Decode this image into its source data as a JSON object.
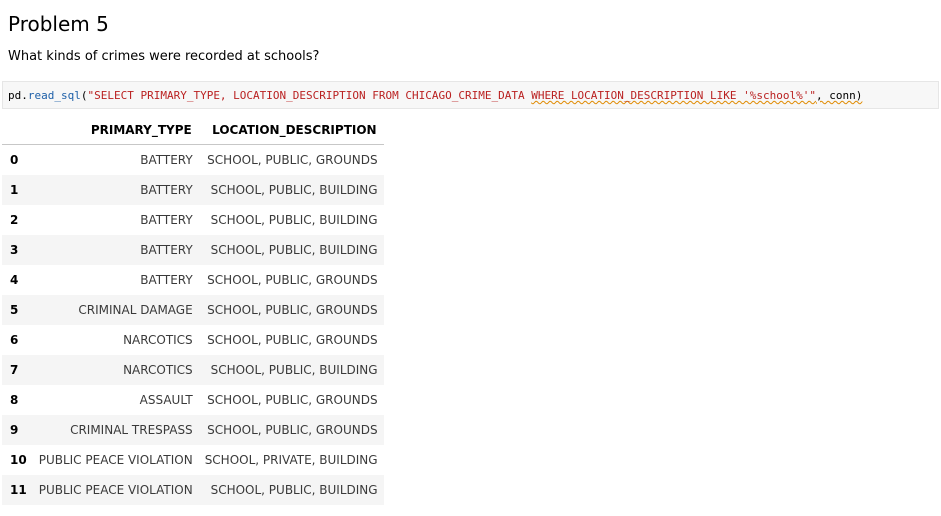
{
  "heading": "Problem 5",
  "question": "What kinds of crimes were recorded at schools?",
  "code": {
    "prefix_obj": "pd.",
    "prefix_func": "read_sql",
    "open_paren": "(",
    "sql_part1": "\"SELECT PRIMARY_TYPE, LOCATION_DESCRIPTION FROM CHICAGO_CRIME_DATA ",
    "sql_part2": "WHERE LOCATION_DESCRIPTION LIKE '%school%'\"",
    "tail": ", conn)"
  },
  "table": {
    "columns": [
      "PRIMARY_TYPE",
      "LOCATION_DESCRIPTION"
    ],
    "rows": [
      {
        "index": "0",
        "primary_type": "BATTERY",
        "location": "SCHOOL, PUBLIC, GROUNDS"
      },
      {
        "index": "1",
        "primary_type": "BATTERY",
        "location": "SCHOOL, PUBLIC, BUILDING"
      },
      {
        "index": "2",
        "primary_type": "BATTERY",
        "location": "SCHOOL, PUBLIC, BUILDING"
      },
      {
        "index": "3",
        "primary_type": "BATTERY",
        "location": "SCHOOL, PUBLIC, BUILDING"
      },
      {
        "index": "4",
        "primary_type": "BATTERY",
        "location": "SCHOOL, PUBLIC, GROUNDS"
      },
      {
        "index": "5",
        "primary_type": "CRIMINAL DAMAGE",
        "location": "SCHOOL, PUBLIC, GROUNDS"
      },
      {
        "index": "6",
        "primary_type": "NARCOTICS",
        "location": "SCHOOL, PUBLIC, GROUNDS"
      },
      {
        "index": "7",
        "primary_type": "NARCOTICS",
        "location": "SCHOOL, PUBLIC, BUILDING"
      },
      {
        "index": "8",
        "primary_type": "ASSAULT",
        "location": "SCHOOL, PUBLIC, GROUNDS"
      },
      {
        "index": "9",
        "primary_type": "CRIMINAL TRESPASS",
        "location": "SCHOOL, PUBLIC, GROUNDS"
      },
      {
        "index": "10",
        "primary_type": "PUBLIC PEACE VIOLATION",
        "location": "SCHOOL, PRIVATE, BUILDING"
      },
      {
        "index": "11",
        "primary_type": "PUBLIC PEACE VIOLATION",
        "location": "SCHOOL, PUBLIC, BUILDING"
      }
    ]
  }
}
